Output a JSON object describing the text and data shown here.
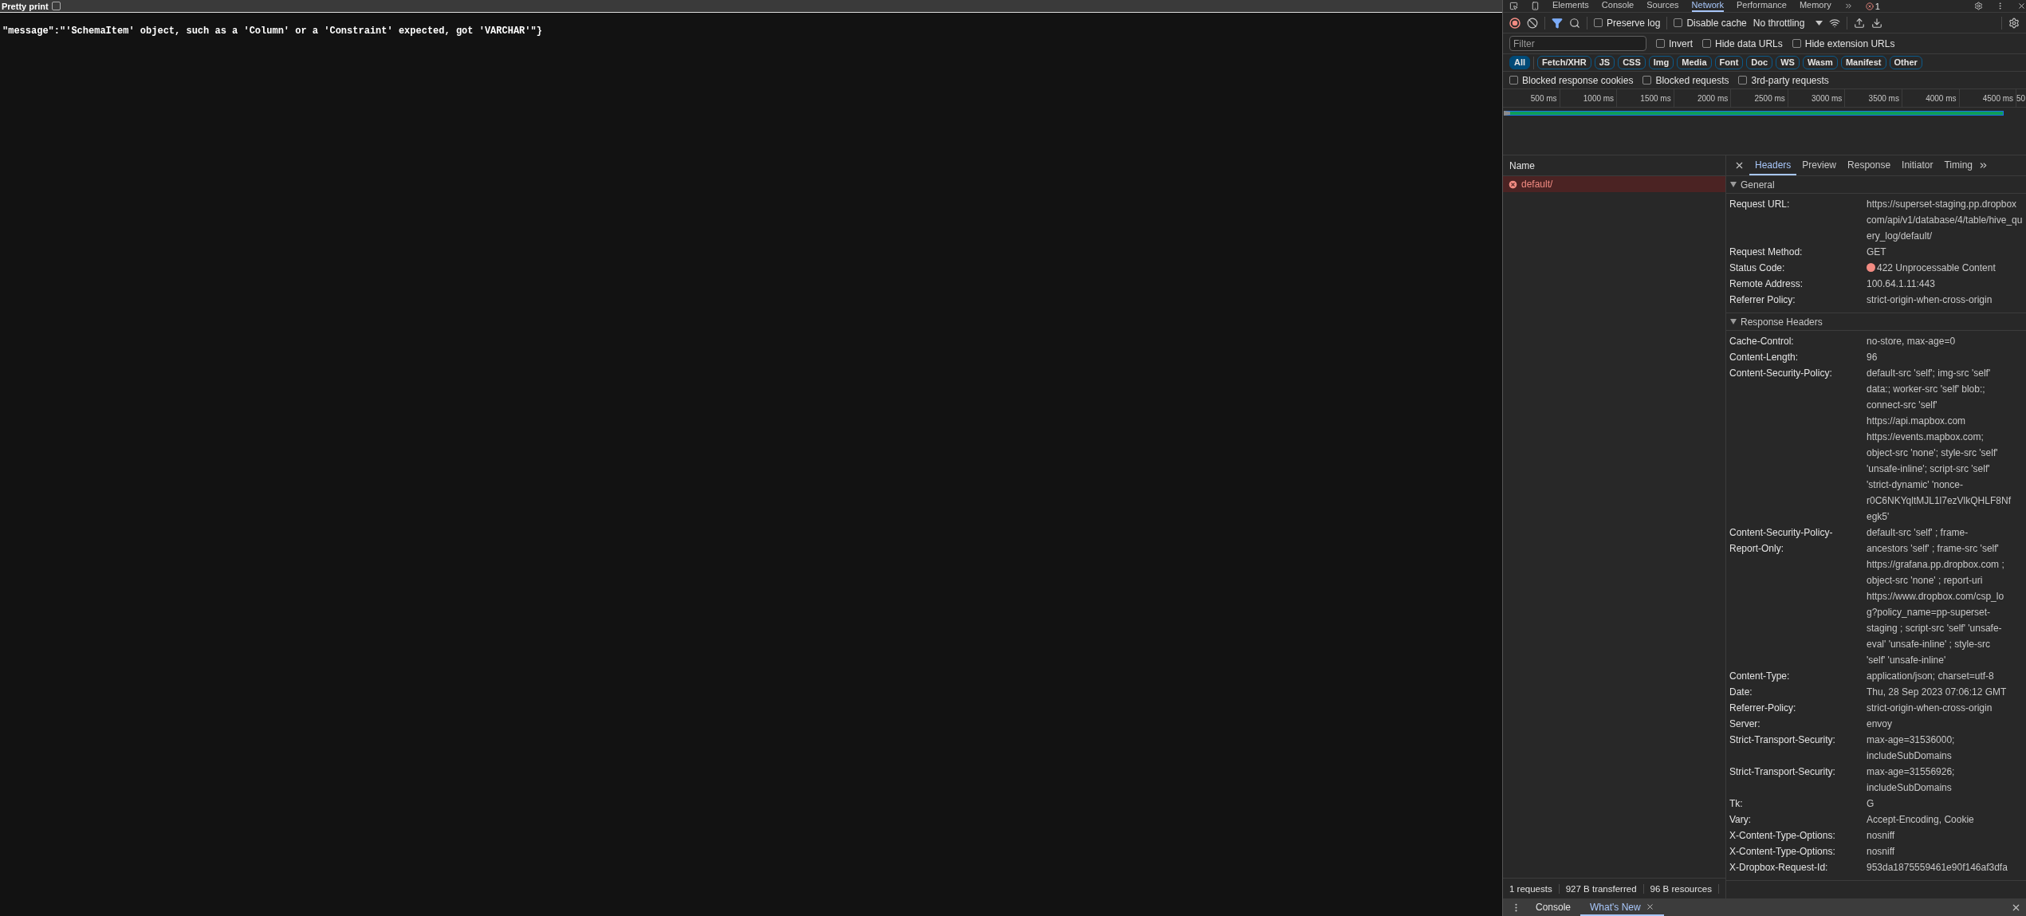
{
  "page": {
    "pretty_print": {
      "label": "Pretty print",
      "checked": false
    },
    "body": "\"message\":\"'SchemaItem' object, such as a 'Column' or a 'Constraint' expected, got 'VARCHAR'\"}"
  },
  "devtools": {
    "tabs": [
      {
        "label": "Elements",
        "selected": false
      },
      {
        "label": "Console",
        "selected": false
      },
      {
        "label": "Sources",
        "selected": false
      },
      {
        "label": "Network",
        "selected": true
      },
      {
        "label": "Performance",
        "selected": false
      },
      {
        "label": "Memory",
        "selected": false
      }
    ],
    "error_count": "1",
    "toolbar": {
      "recording": true,
      "options": [
        {
          "label": "Preserve log",
          "checked": false
        },
        {
          "label": "Disable cache",
          "checked": false
        }
      ],
      "throttling": "No throttling"
    },
    "filter": {
      "placeholder": "Filter"
    },
    "filter_options": [
      {
        "label": "Invert",
        "checked": false
      },
      {
        "label": "Hide data URLs",
        "checked": false
      },
      {
        "label": "Hide extension URLs",
        "checked": false
      }
    ],
    "type_filters": [
      {
        "label": "All",
        "selected": true
      },
      {
        "label": "Fetch/XHR",
        "selected": false
      },
      {
        "label": "JS",
        "selected": false
      },
      {
        "label": "CSS",
        "selected": false
      },
      {
        "label": "Img",
        "selected": false
      },
      {
        "label": "Media",
        "selected": false
      },
      {
        "label": "Font",
        "selected": false
      },
      {
        "label": "Doc",
        "selected": false
      },
      {
        "label": "WS",
        "selected": false
      },
      {
        "label": "Wasm",
        "selected": false
      },
      {
        "label": "Manifest",
        "selected": false
      },
      {
        "label": "Other",
        "selected": false
      }
    ],
    "blocked_options": [
      {
        "label": "Blocked response cookies",
        "checked": false
      },
      {
        "label": "Blocked requests",
        "checked": false
      },
      {
        "label": "3rd-party requests",
        "checked": false
      }
    ],
    "timeline_ticks": [
      "500 ms",
      "1000 ms",
      "1500 ms",
      "2000 ms",
      "2500 ms",
      "3000 ms",
      "3500 ms",
      "4000 ms",
      "4500 ms",
      "50"
    ],
    "requests_header": "Name",
    "requests": [
      {
        "name": "default/",
        "error": true,
        "selected": true
      }
    ],
    "detail_tabs": [
      {
        "label": "Headers",
        "selected": true
      },
      {
        "label": "Preview",
        "selected": false
      },
      {
        "label": "Response",
        "selected": false
      },
      {
        "label": "Initiator",
        "selected": false
      },
      {
        "label": "Timing",
        "selected": false
      }
    ],
    "sections": [
      {
        "title": "General",
        "expanded": true,
        "rows": [
          {
            "name": "Request URL:",
            "value": [
              "https://superset-staging.pp.dropbox",
              "com/api/v1/database/4/table/hive_qu",
              "ery_log/default/"
            ]
          },
          {
            "name": "Request Method:",
            "value": [
              "GET"
            ]
          },
          {
            "name": "Status Code:",
            "value": [
              "422 Unprocessable Content"
            ],
            "color": "#f28b82"
          },
          {
            "name": "Remote Address:",
            "value": [
              "100.64.1.11:443"
            ]
          },
          {
            "name": "Referrer Policy:",
            "value": [
              "strict-origin-when-cross-origin"
            ]
          }
        ]
      },
      {
        "title": "Response Headers",
        "expanded": true,
        "rows": [
          {
            "name": "Cache-Control:",
            "value": [
              "no-store, max-age=0"
            ]
          },
          {
            "name": "Content-Length:",
            "value": [
              "96"
            ]
          },
          {
            "name": "Content-Security-Policy:",
            "value": [
              "default-src 'self'; img-src 'self'",
              "data:; worker-src 'self' blob:;",
              "connect-src 'self'",
              "https://api.mapbox.com",
              "https://events.mapbox.com;",
              "object-src 'none'; style-src 'self'",
              "'unsafe-inline'; script-src 'self'",
              "'strict-dynamic' 'nonce-",
              "r0C6NKYqltMJL1l7ezVlkQHLF8Nf",
              "egk5'"
            ]
          },
          {
            "name": "Content-Security-Policy-Report-Only:",
            "value": [
              "default-src 'self' ; frame-",
              "ancestors 'self' ; frame-src 'self'",
              "https://grafana.pp.dropbox.com ;",
              "object-src 'none' ; report-uri",
              "https://www.dropbox.com/csp_lo",
              "g?policy_name=pp-superset-",
              "staging ; script-src 'self' 'unsafe-",
              "eval' 'unsafe-inline' ; style-src",
              "'self' 'unsafe-inline'"
            ]
          },
          {
            "name": "Content-Type:",
            "value": [
              "application/json; charset=utf-8"
            ]
          },
          {
            "name": "Date:",
            "value": [
              "Thu, 28 Sep 2023 07:06:12 GMT"
            ]
          },
          {
            "name": "Referrer-Policy:",
            "value": [
              "strict-origin-when-cross-origin"
            ]
          },
          {
            "name": "Server:",
            "value": [
              "envoy"
            ]
          },
          {
            "name": "Strict-Transport-Security:",
            "value": [
              "max-age=31536000;",
              "includeSubDomains"
            ]
          },
          {
            "name": "Strict-Transport-Security:",
            "value": [
              "max-age=31556926;",
              "includeSubDomains"
            ]
          },
          {
            "name": "Tk:",
            "value": [
              "G"
            ]
          },
          {
            "name": "Vary:",
            "value": [
              "Accept-Encoding, Cookie"
            ]
          },
          {
            "name": "X-Content-Type-Options:",
            "value": [
              "nosniff"
            ]
          },
          {
            "name": "X-Content-Type-Options:",
            "value": [
              "nosniff"
            ]
          },
          {
            "name": "X-Dropbox-Request-Id:",
            "value": [
              "953da1875559461e90f146af3dfa"
            ]
          }
        ]
      }
    ],
    "status": [
      "1 requests",
      "927 B transferred",
      "96 B resources"
    ],
    "drawer_tabs": [
      {
        "label": "Console",
        "selected": false,
        "closable": false
      },
      {
        "label": "What's New",
        "selected": true,
        "closable": true
      }
    ]
  }
}
